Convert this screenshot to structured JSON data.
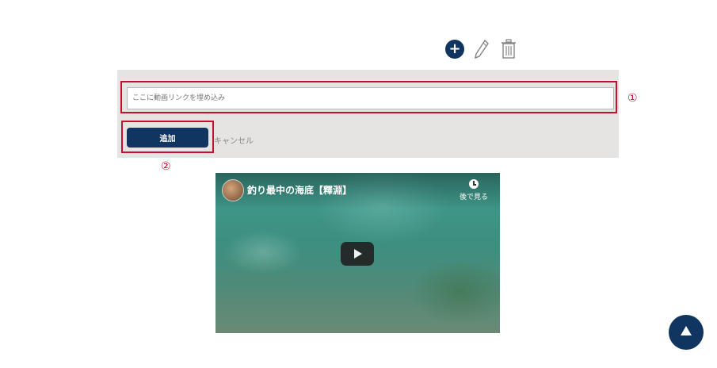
{
  "toolbar": {
    "add_icon": "plus-circle-icon",
    "edit_icon": "pencil-icon",
    "delete_icon": "trash-icon"
  },
  "form": {
    "input_placeholder": "ここに動画リンクを埋め込み",
    "input_value": "",
    "add_label": "追加",
    "cancel_label": "キャンセル"
  },
  "annotations": {
    "marker_1": "①",
    "marker_2": "②"
  },
  "video": {
    "title": "釣り最中の海底【釋淵】",
    "watch_later_label": "後で見る",
    "play_icon": "play-icon"
  },
  "colors": {
    "accent": "#0f3560",
    "highlight": "#c8102e",
    "panel": "#e6e4e3"
  }
}
